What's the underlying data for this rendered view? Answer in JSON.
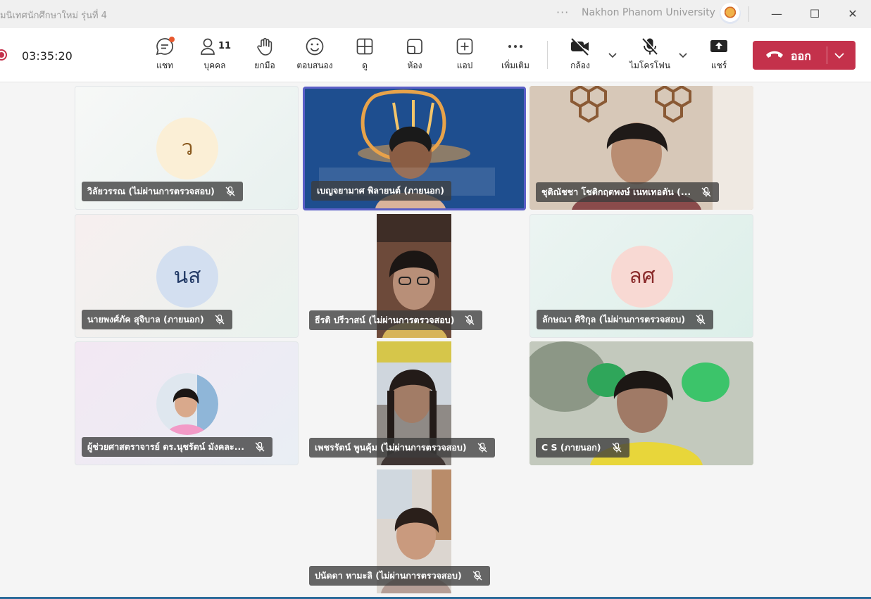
{
  "window": {
    "meeting_title": "มนิเทศนักศึกษาใหม่ รุ่นที่ 4",
    "more_glyph": "···",
    "org_name": "Nakhon Phanom University",
    "minimize": "—",
    "maximize": "☐",
    "close": "✕"
  },
  "toolbar": {
    "timer": "03:35:20",
    "chat_label": "แชท",
    "people_label": "บุคคล",
    "people_count": "11",
    "raise_label": "ยกมือ",
    "react_label": "ตอบสนอง",
    "view_label": "ดู",
    "rooms_label": "ห้อง",
    "apps_label": "แอป",
    "more_label": "เพิ่มเติม",
    "camera_label": "กล้อง",
    "mic_label": "ไมโครโฟน",
    "share_label": "แชร์",
    "leave_label": "ออก"
  },
  "tiles": [
    {
      "name": "วิลัยวรรณ (ไม่ผ่านการตรวจสอบ)",
      "initials": "ว"
    },
    {
      "name": "เบญจยามาศ พิลายนต์ (ภายนอก)"
    },
    {
      "name": "ชุติณัชชา โชติกฤตพงษ์ เนทเทอตัน (..."
    },
    {
      "name": "นายพงศ์ภัค สุจิบาล (ภายนอก)",
      "initials": "นส"
    },
    {
      "name": "ธีรติ ปรีวาสน์ (ไม่ผ่านการตรวจสอบ)"
    },
    {
      "name": "ลักษณา ศิริกุล (ไม่ผ่านการตรวจสอบ)",
      "initials": "ลศ"
    },
    {
      "name": "ผู้ช่วยศาสตราจารย์ ดร.นุชรัตน์ มังคละ..."
    },
    {
      "name": "เพชรรัตน์ พูนคุ้ม (ไม่ผ่านการตรวจสอบ)"
    },
    {
      "name": "C S (ภายนอก)"
    },
    {
      "name": "ปนัดดา หามะลิ (ไม่ผ่านการตรวจสอบ)"
    }
  ],
  "colors": {
    "accent": "#5b5fc7",
    "leave": "#c4314b",
    "recording": "#c4314b",
    "badge": "#e8582e"
  }
}
